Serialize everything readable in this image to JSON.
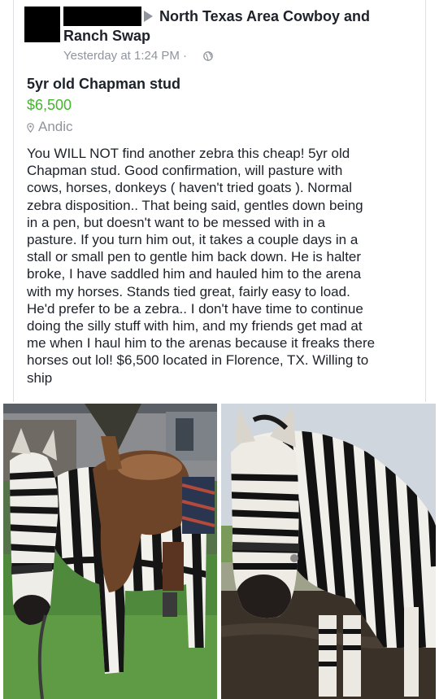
{
  "post": {
    "group_line1": "North Texas Area Cowboy and",
    "group_line2": "Ranch Swap",
    "timestamp": "Yesterday at 1:24 PM ·",
    "privacy_icon": "globe-icon"
  },
  "listing": {
    "title": "5yr old Chapman stud",
    "price": "$6,500",
    "price_color": "#42b72a",
    "location": "Andic",
    "location_icon": "pin-icon",
    "description_lines": [
      "You WILL NOT find another zebra this cheap! 5yr old",
      "Chapman stud. Good confirmation, will pasture with",
      "cows, horses, donkeys ( haven't tried goats ). Normal",
      "zebra disposition.. That being said, gentles down being",
      "in a pen, but doesn't want to be messed with in a",
      "pasture. If you turn him out, it takes a couple days in a",
      "stall or small pen to gentle him back down. He is halter",
      "broke, I have saddled him and hauled him to the arena",
      "with my horses. Stands tied great, fairly easy to load.",
      "He'd prefer to be a zebra.. I don't have time to continue",
      "doing the silly stuff with him, and my friends get mad at",
      "me when I haul him to the arenas because it freaks there",
      "horses out lol! $6,500 located in Florence, TX. Willing to",
      "ship"
    ]
  },
  "photos": [
    "zebra-with-saddle-photo",
    "zebra-portrait-photo"
  ]
}
